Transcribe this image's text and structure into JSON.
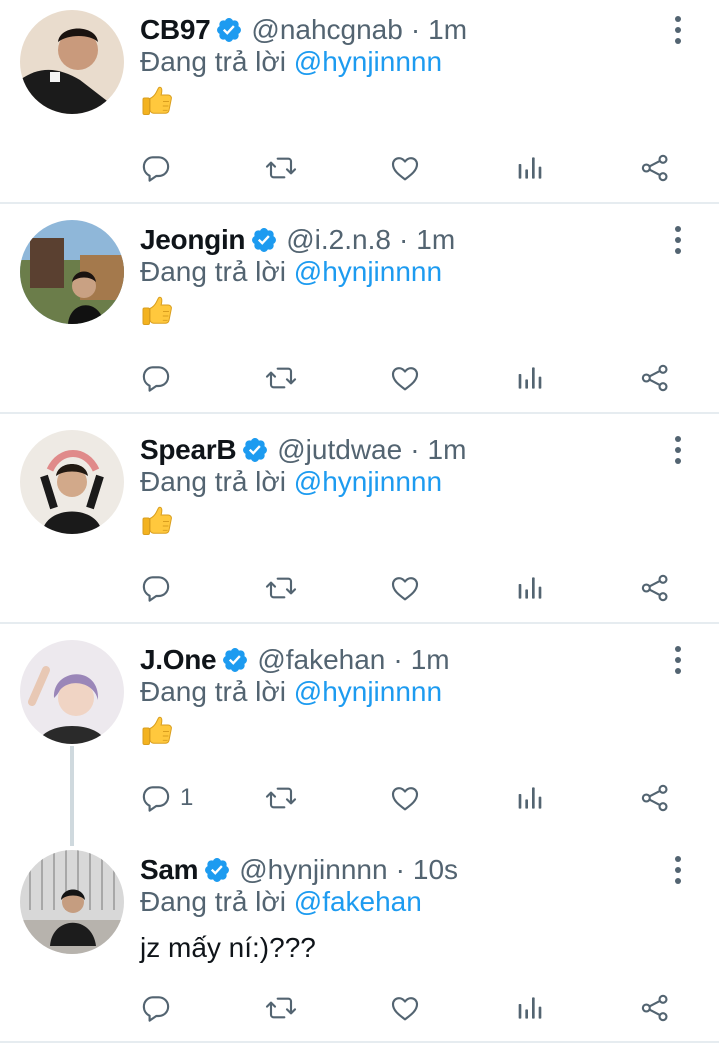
{
  "replying_prefix": "Đang trả lời",
  "tweets": [
    {
      "name": "CB97",
      "handle": "@nahcgnab",
      "dot": "·",
      "time": "1m",
      "reply_to": "@hynjinnnn",
      "text": "",
      "emoji": "thumbs-up",
      "reply_count": ""
    },
    {
      "name": "Jeongin",
      "handle": "@i.2.n.8",
      "dot": "·",
      "time": "1m",
      "reply_to": "@hynjinnnn",
      "text": "",
      "emoji": "thumbs-up",
      "reply_count": ""
    },
    {
      "name": "SpearB",
      "handle": "@jutdwae",
      "dot": "·",
      "time": "1m",
      "reply_to": "@hynjinnnn",
      "text": "",
      "emoji": "thumbs-up",
      "reply_count": ""
    },
    {
      "name": "J.One",
      "handle": "@fakehan",
      "dot": "·",
      "time": "1m",
      "reply_to": "@hynjinnnn",
      "text": "",
      "emoji": "thumbs-up",
      "reply_count": "1"
    },
    {
      "name": "Sam",
      "handle": "@hynjinnnn",
      "dot": "·",
      "time": "10s",
      "reply_to": "@fakehan",
      "text": "jz mấy ní:)???",
      "emoji": "",
      "reply_count": ""
    }
  ],
  "colors": {
    "accent": "#1d9bf0",
    "secondary_text": "#536471",
    "divider": "#e6ecf0",
    "emoji": "#ffc83d"
  },
  "icons": [
    "verified-badge-icon",
    "more-options-icon",
    "reply-icon",
    "retweet-icon",
    "like-icon",
    "analytics-icon",
    "share-icon"
  ]
}
